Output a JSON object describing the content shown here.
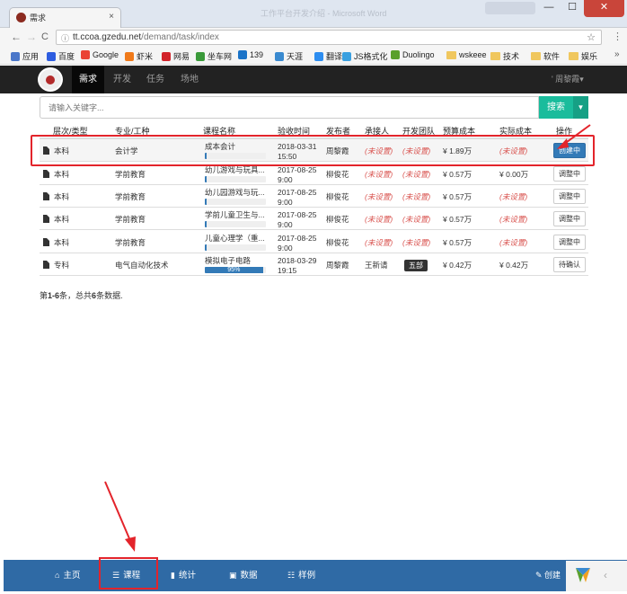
{
  "browser": {
    "tab_title": "需求",
    "window_title": "工作平台开发介绍 - Microsoft Word",
    "controls": {
      "minimize": "—",
      "maximize": "☐",
      "close": "✕"
    },
    "back": "←",
    "forward": "→",
    "reload": "C",
    "url_host": "tt.ccoa.gzedu.net",
    "url_path": "/demand/task/index",
    "bookmarks_more": "»",
    "bookmarks": [
      {
        "label": "应用",
        "color": "#4a76c9"
      },
      {
        "label": "百度",
        "color": "#2d5de0"
      },
      {
        "label": "Google",
        "color": "#ea4335"
      },
      {
        "label": "虾米",
        "color": "#f07a1a"
      },
      {
        "label": "网易",
        "color": "#d2232a"
      },
      {
        "label": "坐车网",
        "color": "#3a9a3a"
      },
      {
        "label": "139",
        "color": "#1a73c8"
      },
      {
        "label": "天涯",
        "color": "#3a8ad0"
      },
      {
        "label": "翻译",
        "color": "#2d8df0"
      },
      {
        "label": "JS格式化",
        "color": "#3aa0e0"
      },
      {
        "label": "Duolingo",
        "color": "#5aa02c"
      },
      {
        "label": "wskeee",
        "color": "folder"
      },
      {
        "label": "技术",
        "color": "folder"
      },
      {
        "label": "软件",
        "color": "folder"
      },
      {
        "label": "娱乐",
        "color": "folder"
      }
    ]
  },
  "appnav": {
    "items": [
      "需求",
      "开发",
      "任务",
      "场地"
    ],
    "user": "' 周黎霞▾"
  },
  "search": {
    "placeholder": "请输入关键字...",
    "button": "搜索",
    "caret": "▼"
  },
  "table": {
    "headers": [
      "层次/类型",
      "专业/工种",
      "课程名称",
      "验收时间",
      "发布者",
      "承接人",
      "开发团队",
      "预算成本",
      "实际成本",
      "操作"
    ],
    "rows": [
      {
        "level": "本科",
        "major": "会计学",
        "course": "成本会计",
        "date": "2018-03-31",
        "time": "15:50",
        "publisher": "周黎霞",
        "taker": "(未设置)",
        "team": "(未设置)",
        "budget": "¥ 1.89万",
        "actual": "(未设置)",
        "op": "创建中",
        "progress": 0.03
      },
      {
        "level": "本科",
        "major": "学前教育",
        "course": "幼儿游戏与玩具...",
        "date": "2017-08-25",
        "time": "9:00",
        "publisher": "柳俊花",
        "taker": "(未设置)",
        "team": "(未设置)",
        "budget": "¥ 0.57万",
        "actual": "¥ 0.00万",
        "op": "调整中",
        "progress": 0.03
      },
      {
        "level": "本科",
        "major": "学前教育",
        "course": "幼儿园游戏与玩...",
        "date": "2017-08-25",
        "time": "9:00",
        "publisher": "柳俊花",
        "taker": "(未设置)",
        "team": "(未设置)",
        "budget": "¥ 0.57万",
        "actual": "(未设置)",
        "op": "调整中",
        "progress": 0.03
      },
      {
        "level": "本科",
        "major": "学前教育",
        "course": "学前儿童卫生与...",
        "date": "2017-08-25",
        "time": "9:00",
        "publisher": "柳俊花",
        "taker": "(未设置)",
        "team": "(未设置)",
        "budget": "¥ 0.57万",
        "actual": "(未设置)",
        "op": "调整中",
        "progress": 0.03
      },
      {
        "level": "本科",
        "major": "学前教育",
        "course": "儿童心理学（重...",
        "date": "2017-08-25",
        "time": "9:00",
        "publisher": "柳俊花",
        "taker": "(未设置)",
        "team": "(未设置)",
        "budget": "¥ 0.57万",
        "actual": "(未设置)",
        "op": "调整中",
        "progress": 0.03
      },
      {
        "level": "专科",
        "major": "电气自动化技术",
        "course": "模拟电子电路",
        "date": "2018-03-29",
        "time": "19:15",
        "publisher": "周黎霞",
        "taker": "王新请",
        "team": "五部",
        "budget": "¥ 0.42万",
        "actual": "¥ 0.42万",
        "op": "待确认",
        "progress": 0.95,
        "progress_label": "95%"
      }
    ]
  },
  "summary": {
    "pre": "第",
    "range": "1-6",
    "mid": "条，总共",
    "total": "6",
    "post": "条数据."
  },
  "bottomnav": {
    "items": [
      "主页",
      "课程",
      "统计",
      "数据",
      "样例"
    ],
    "right": "创建"
  },
  "colors": {
    "nav": "#222222",
    "search": "#1abc9c",
    "primary": "#337ab7",
    "bottombar": "#2f6aa5",
    "annotation": "#e3242b"
  }
}
